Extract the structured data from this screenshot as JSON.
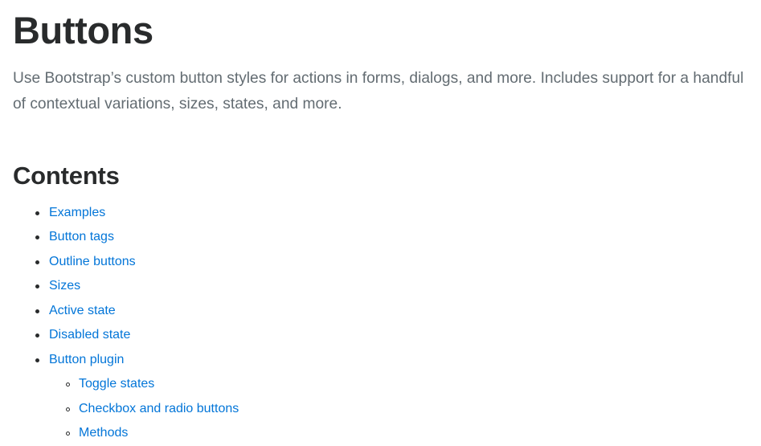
{
  "page": {
    "title": "Buttons",
    "lead": "Use Bootstrap’s custom button styles for actions in forms, dialogs, and more. Includes support for a handful of contextual variations, sizes, states, and more."
  },
  "contents": {
    "heading": "Contents",
    "items": [
      {
        "label": "Examples"
      },
      {
        "label": "Button tags"
      },
      {
        "label": "Outline buttons"
      },
      {
        "label": "Sizes"
      },
      {
        "label": "Active state"
      },
      {
        "label": "Disabled state"
      },
      {
        "label": "Button plugin",
        "children": [
          {
            "label": "Toggle states"
          },
          {
            "label": "Checkbox and radio buttons"
          },
          {
            "label": "Methods"
          }
        ]
      }
    ]
  },
  "colors": {
    "link": "#0275d8",
    "heading": "#292b2c",
    "lead": "#636c72",
    "background": "#ffffff"
  }
}
